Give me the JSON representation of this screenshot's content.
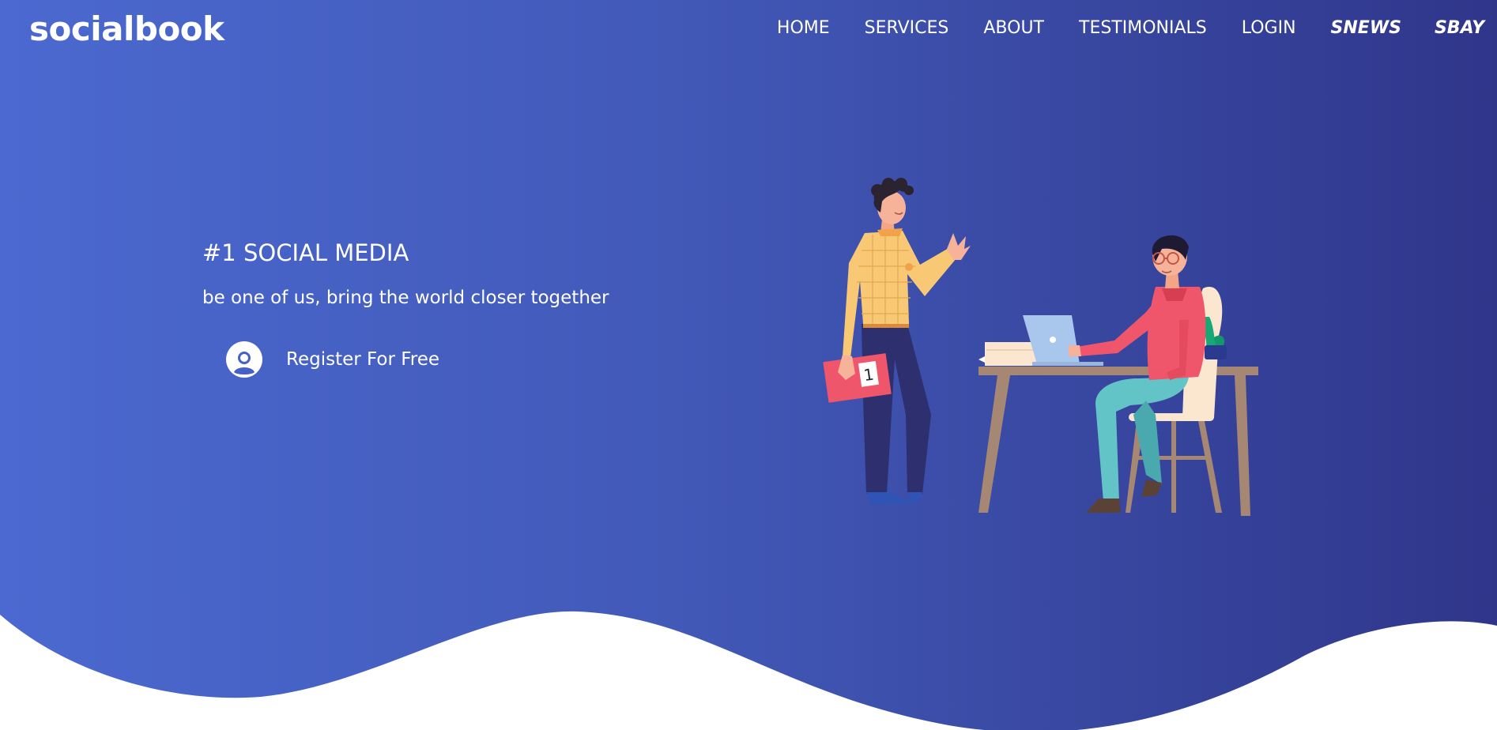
{
  "brand": {
    "logo_text": "socialbook"
  },
  "nav": {
    "items": [
      {
        "label": "HOME"
      },
      {
        "label": "SERVICES"
      },
      {
        "label": "ABOUT"
      },
      {
        "label": "TESTIMONIALS"
      },
      {
        "label": "LOGIN"
      },
      {
        "label": "SNEWS"
      },
      {
        "label": "SBAY"
      }
    ]
  },
  "hero": {
    "headline": "#1 SOCIAL MEDIA",
    "tagline": "be one of us, bring the world closer together",
    "cta_label": "Register For Free",
    "cta_icon": "user-circle-icon",
    "illustration": "two-people-office-illustration",
    "book_badge": "1"
  },
  "colors": {
    "gradient_start": "#4b69d0",
    "gradient_end": "#2f368a",
    "text": "#ffffff",
    "wave": "#ffffff"
  }
}
